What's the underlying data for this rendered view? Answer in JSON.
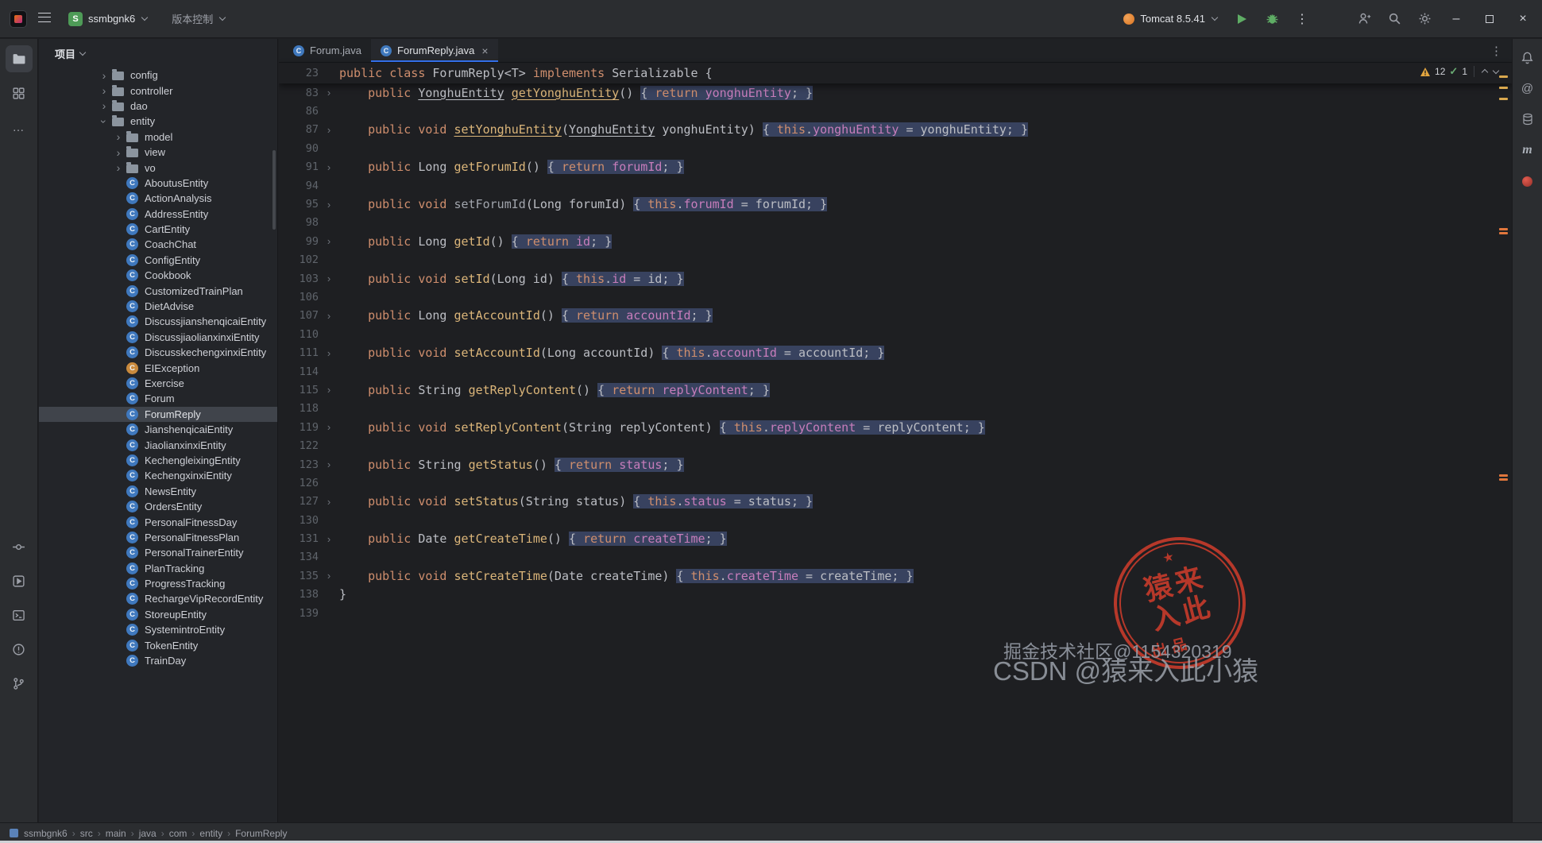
{
  "colors": {
    "accent": "#3574f0",
    "run_green": "#5fad65",
    "warning": "#e2a53f",
    "stamp_red": "#bf3a2b",
    "selection": "#40444b",
    "highlight": "#38425f"
  },
  "icons": {
    "chevron": "›",
    "fold": "›",
    "class_letter": "C",
    "kebab": "⋮",
    "more": "…",
    "at": "@",
    "maven": "m",
    "min": "–",
    "tab_close": "×",
    "close": "×",
    "crumb_sep": "›",
    "star": "★",
    "check": "✓"
  },
  "titlebar": {
    "project_initial": "S",
    "project_name": "ssmbgnk6",
    "vcs_label": "版本控制",
    "run_config": "Tomcat 8.5.41"
  },
  "project_panel": {
    "title": "项目",
    "tree": [
      {
        "l": "config",
        "i": "f",
        "d": 0,
        "x": "c"
      },
      {
        "l": "controller",
        "i": "f",
        "d": 0,
        "x": "c"
      },
      {
        "l": "dao",
        "i": "f",
        "d": 0,
        "x": "c"
      },
      {
        "l": "entity",
        "i": "f",
        "d": 0,
        "x": "o"
      },
      {
        "l": "model",
        "i": "f",
        "d": 1,
        "x": "c"
      },
      {
        "l": "view",
        "i": "f",
        "d": 1,
        "x": "c"
      },
      {
        "l": "vo",
        "i": "f",
        "d": 1,
        "x": "c"
      },
      {
        "l": "AboutusEntity",
        "i": "c",
        "d": 1
      },
      {
        "l": "ActionAnalysis",
        "i": "c",
        "d": 1
      },
      {
        "l": "AddressEntity",
        "i": "c",
        "d": 1
      },
      {
        "l": "CartEntity",
        "i": "c",
        "d": 1
      },
      {
        "l": "CoachChat",
        "i": "c",
        "d": 1
      },
      {
        "l": "ConfigEntity",
        "i": "c",
        "d": 1
      },
      {
        "l": "Cookbook",
        "i": "c",
        "d": 1
      },
      {
        "l": "CustomizedTrainPlan",
        "i": "c",
        "d": 1
      },
      {
        "l": "DietAdvise",
        "i": "c",
        "d": 1
      },
      {
        "l": "DiscussjianshenqicaiEntity",
        "i": "c",
        "d": 1
      },
      {
        "l": "DiscussjiaolianxinxiEntity",
        "i": "c",
        "d": 1
      },
      {
        "l": "DiscusskechengxinxiEntity",
        "i": "c",
        "d": 1
      },
      {
        "l": "EIException",
        "i": "e",
        "d": 1
      },
      {
        "l": "Exercise",
        "i": "c",
        "d": 1
      },
      {
        "l": "Forum",
        "i": "c",
        "d": 1
      },
      {
        "l": "ForumReply",
        "i": "c",
        "d": 1,
        "sel": true
      },
      {
        "l": "JianshenqicaiEntity",
        "i": "c",
        "d": 1
      },
      {
        "l": "JiaolianxinxiEntity",
        "i": "c",
        "d": 1
      },
      {
        "l": "KechengleixingEntity",
        "i": "c",
        "d": 1
      },
      {
        "l": "KechengxinxiEntity",
        "i": "c",
        "d": 1
      },
      {
        "l": "NewsEntity",
        "i": "c",
        "d": 1
      },
      {
        "l": "OrdersEntity",
        "i": "c",
        "d": 1
      },
      {
        "l": "PersonalFitnessDay",
        "i": "c",
        "d": 1
      },
      {
        "l": "PersonalFitnessPlan",
        "i": "c",
        "d": 1
      },
      {
        "l": "PersonalTrainerEntity",
        "i": "c",
        "d": 1
      },
      {
        "l": "PlanTracking",
        "i": "c",
        "d": 1
      },
      {
        "l": "ProgressTracking",
        "i": "c",
        "d": 1
      },
      {
        "l": "RechargeVipRecordEntity",
        "i": "c",
        "d": 1
      },
      {
        "l": "StoreupEntity",
        "i": "c",
        "d": 1
      },
      {
        "l": "SystemintroEntity",
        "i": "c",
        "d": 1
      },
      {
        "l": "TokenEntity",
        "i": "c",
        "d": 1
      },
      {
        "l": "TrainDay",
        "i": "c",
        "d": 1
      }
    ]
  },
  "tabs": [
    {
      "label": "Forum.java"
    },
    {
      "label": "ForumReply.java"
    }
  ],
  "editor": {
    "inspections": {
      "warnings": "12",
      "passed": "1"
    },
    "sticky": {
      "n": 23,
      "s": [
        [
          "public class ",
          "k"
        ],
        [
          "ForumReply<T> ",
          "p"
        ],
        [
          "implements ",
          "k"
        ],
        [
          "Serializable {",
          "p"
        ]
      ]
    },
    "lines": [
      {
        "n": 83,
        "f": 1,
        "s": [
          [
            "    public ",
            "k"
          ],
          [
            "YonghuEntity",
            "tu"
          ],
          [
            " ",
            "p"
          ],
          [
            "getYonghuEntity",
            "mu"
          ],
          [
            "() ",
            "p"
          ],
          [
            "{ ",
            "p",
            1
          ],
          [
            "return ",
            "k",
            1
          ],
          [
            "yonghuEntity",
            "f",
            1
          ],
          [
            "; ",
            "p",
            1
          ],
          [
            "}",
            "p",
            1
          ]
        ]
      },
      {
        "n": 86
      },
      {
        "n": 87,
        "f": 1,
        "s": [
          [
            "    public void ",
            "k"
          ],
          [
            "setYonghuEntity",
            "mu"
          ],
          [
            "(",
            "p"
          ],
          [
            "YonghuEntity",
            "tu"
          ],
          [
            " yonghuEntity) ",
            "p"
          ],
          [
            "{ ",
            "p",
            1
          ],
          [
            "this",
            "k",
            1
          ],
          [
            ".",
            "p",
            1
          ],
          [
            "yonghuEntity",
            "f",
            1
          ],
          [
            " = yonghuEntity; ",
            "p",
            1
          ],
          [
            "}",
            "p",
            1
          ]
        ]
      },
      {
        "n": 90
      },
      {
        "n": 91,
        "f": 1,
        "s": [
          [
            "    public ",
            "k"
          ],
          [
            "Long ",
            "p"
          ],
          [
            "getForumId",
            "m"
          ],
          [
            "() ",
            "p"
          ],
          [
            "{ ",
            "p",
            1
          ],
          [
            "return ",
            "k",
            1
          ],
          [
            "forumId",
            "f",
            1
          ],
          [
            "; ",
            "p",
            1
          ],
          [
            "}",
            "p",
            1
          ]
        ]
      },
      {
        "n": 94
      },
      {
        "n": 95,
        "f": 1,
        "s": [
          [
            "    public void ",
            "k"
          ],
          [
            "setForumId",
            "g"
          ],
          [
            "(Long forumId) ",
            "p"
          ],
          [
            "{ ",
            "p",
            1
          ],
          [
            "this",
            "k",
            1
          ],
          [
            ".",
            "p",
            1
          ],
          [
            "forumId",
            "f",
            1
          ],
          [
            " = forumId; ",
            "p",
            1
          ],
          [
            "}",
            "p",
            1
          ]
        ]
      },
      {
        "n": 98
      },
      {
        "n": 99,
        "f": 1,
        "s": [
          [
            "    public ",
            "k"
          ],
          [
            "Long ",
            "p"
          ],
          [
            "getId",
            "m"
          ],
          [
            "() ",
            "p"
          ],
          [
            "{ ",
            "p",
            1
          ],
          [
            "return ",
            "k",
            1
          ],
          [
            "id",
            "f",
            1
          ],
          [
            "; ",
            "p",
            1
          ],
          [
            "}",
            "p",
            1
          ]
        ]
      },
      {
        "n": 102
      },
      {
        "n": 103,
        "f": 1,
        "s": [
          [
            "    public void ",
            "k"
          ],
          [
            "setId",
            "m"
          ],
          [
            "(Long id) ",
            "p"
          ],
          [
            "{ ",
            "p",
            1
          ],
          [
            "this",
            "k",
            1
          ],
          [
            ".",
            "p",
            1
          ],
          [
            "id",
            "f",
            1
          ],
          [
            " = id; ",
            "p",
            1
          ],
          [
            "}",
            "p",
            1
          ]
        ]
      },
      {
        "n": 106
      },
      {
        "n": 107,
        "f": 1,
        "s": [
          [
            "    public ",
            "k"
          ],
          [
            "Long ",
            "p"
          ],
          [
            "getAccountId",
            "m"
          ],
          [
            "() ",
            "p"
          ],
          [
            "{ ",
            "p",
            1
          ],
          [
            "return ",
            "k",
            1
          ],
          [
            "accountId",
            "f",
            1
          ],
          [
            "; ",
            "p",
            1
          ],
          [
            "}",
            "p",
            1
          ]
        ]
      },
      {
        "n": 110
      },
      {
        "n": 111,
        "f": 1,
        "s": [
          [
            "    public void ",
            "k"
          ],
          [
            "setAccountId",
            "m"
          ],
          [
            "(Long accountId) ",
            "p"
          ],
          [
            "{ ",
            "p",
            1
          ],
          [
            "this",
            "k",
            1
          ],
          [
            ".",
            "p",
            1
          ],
          [
            "accountId",
            "f",
            1
          ],
          [
            " = accountId; ",
            "p",
            1
          ],
          [
            "}",
            "p",
            1
          ]
        ]
      },
      {
        "n": 114
      },
      {
        "n": 115,
        "f": 1,
        "s": [
          [
            "    public ",
            "k"
          ],
          [
            "String ",
            "p"
          ],
          [
            "getReplyContent",
            "m"
          ],
          [
            "() ",
            "p"
          ],
          [
            "{ ",
            "p",
            1
          ],
          [
            "return ",
            "k",
            1
          ],
          [
            "replyContent",
            "f",
            1
          ],
          [
            "; ",
            "p",
            1
          ],
          [
            "}",
            "p",
            1
          ]
        ]
      },
      {
        "n": 118
      },
      {
        "n": 119,
        "f": 1,
        "s": [
          [
            "    public void ",
            "k"
          ],
          [
            "setReplyContent",
            "m"
          ],
          [
            "(String replyContent) ",
            "p"
          ],
          [
            "{ ",
            "p",
            1
          ],
          [
            "this",
            "k",
            1
          ],
          [
            ".",
            "p",
            1
          ],
          [
            "replyContent",
            "f",
            1
          ],
          [
            " = replyContent; ",
            "p",
            1
          ],
          [
            "}",
            "p",
            1
          ]
        ]
      },
      {
        "n": 122
      },
      {
        "n": 123,
        "f": 1,
        "s": [
          [
            "    public ",
            "k"
          ],
          [
            "String ",
            "p"
          ],
          [
            "getStatus",
            "m"
          ],
          [
            "() ",
            "p"
          ],
          [
            "{ ",
            "p",
            1
          ],
          [
            "return ",
            "k",
            1
          ],
          [
            "status",
            "f",
            1
          ],
          [
            "; ",
            "p",
            1
          ],
          [
            "}",
            "p",
            1
          ]
        ]
      },
      {
        "n": 126
      },
      {
        "n": 127,
        "f": 1,
        "s": [
          [
            "    public void ",
            "k"
          ],
          [
            "setStatus",
            "m"
          ],
          [
            "(String status) ",
            "p"
          ],
          [
            "{ ",
            "p",
            1
          ],
          [
            "this",
            "k",
            1
          ],
          [
            ".",
            "p",
            1
          ],
          [
            "status",
            "f",
            1
          ],
          [
            " = status; ",
            "p",
            1
          ],
          [
            "}",
            "p",
            1
          ]
        ]
      },
      {
        "n": 130
      },
      {
        "n": 131,
        "f": 1,
        "s": [
          [
            "    public ",
            "k"
          ],
          [
            "Date ",
            "p"
          ],
          [
            "getCreateTime",
            "m"
          ],
          [
            "() ",
            "p"
          ],
          [
            "{ ",
            "p",
            1
          ],
          [
            "return ",
            "k",
            1
          ],
          [
            "createTime",
            "f",
            1
          ],
          [
            "; ",
            "p",
            1
          ],
          [
            "}",
            "p",
            1
          ]
        ]
      },
      {
        "n": 134
      },
      {
        "n": 135,
        "f": 1,
        "s": [
          [
            "    public void ",
            "k"
          ],
          [
            "setCreateTime",
            "m"
          ],
          [
            "(Date createTime) ",
            "p"
          ],
          [
            "{ ",
            "p",
            1
          ],
          [
            "this",
            "k",
            1
          ],
          [
            ".",
            "p",
            1
          ],
          [
            "createTime",
            "f",
            1
          ],
          [
            " = createTime; ",
            "p",
            1
          ],
          [
            "}",
            "p",
            1
          ]
        ]
      },
      {
        "n": 138,
        "s": [
          [
            "}",
            "p"
          ]
        ]
      },
      {
        "n": 139
      }
    ]
  },
  "statusbar": {
    "breadcrumbs": [
      "ssmbgnk6",
      "src",
      "main",
      "java",
      "com",
      "entity",
      "ForumReply"
    ]
  },
  "watermarks": {
    "stamp_line1": "猿来",
    "stamp_line2": "入此",
    "stamp_sub": "出品",
    "text1": "掘金技术社区@1154320319",
    "text2": "CSDN @猿来入此小猿"
  }
}
